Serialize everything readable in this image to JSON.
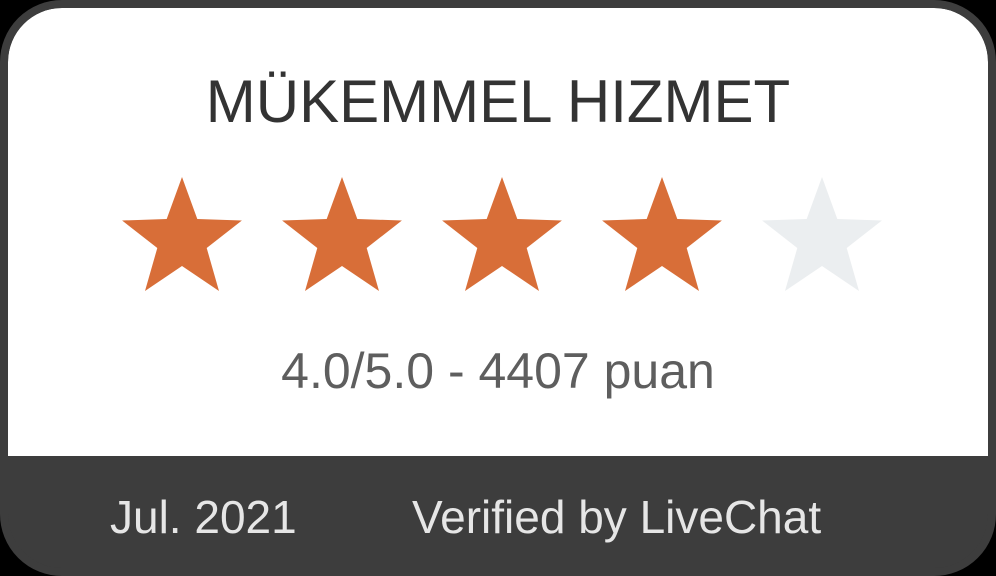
{
  "badge": {
    "title": "MÜKEMMEL HIZMET",
    "rating": {
      "value": 4,
      "max": 5,
      "text": "4.0/5.0 - 4407 puan"
    },
    "footer": {
      "date": "Jul. 2021",
      "verified": "Verified by LiveChat"
    },
    "icons": [
      "star-icon"
    ],
    "colors": {
      "star_filled": "#d86e38",
      "star_empty": "#ebeef0",
      "frame": "#3d3d3d",
      "footer_text": "#e6e6e6"
    }
  }
}
